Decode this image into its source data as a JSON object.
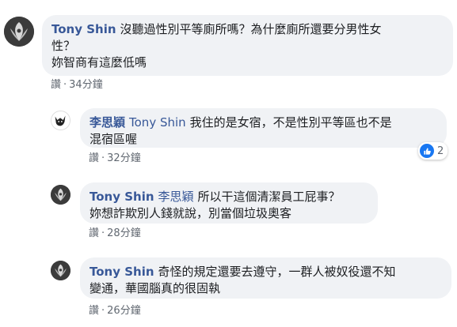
{
  "colors": {
    "bubble": "#f0f2f5",
    "author": "#385898",
    "like": "#1877f2",
    "meta": "#606770"
  },
  "comments": [
    {
      "author": "Tony Shin",
      "mention": "",
      "line1": "沒聽過性別平等廁所嗎？為什麼廁所還要分男性女",
      "line2": "性？",
      "line3": "妳智商有這麼低嗎",
      "action": "讚",
      "time": "34分鐘"
    },
    {
      "author": "李思穎",
      "mention": "Tony Shin",
      "line1": "我住的是女宿，不是性別平等區也不是",
      "line2": "混宿區喔",
      "action": "讚",
      "time": "32分鐘",
      "reaction_count": "2",
      "reaction_icon": "like-icon"
    },
    {
      "author": "Tony Shin",
      "mention": "李思穎",
      "line1": "所以干這個清潔員工屁事？",
      "line2": "妳想詐欺別人錢就說，別當個垃圾奧客",
      "action": "讚",
      "time": "28分鐘"
    },
    {
      "author": "Tony Shin",
      "mention": "",
      "line1": "奇怪的規定還要去遵守，一群人被奴役還不知",
      "line2": "變通，華國腦真的很固執",
      "action": "讚",
      "time": "26分鐘"
    }
  ]
}
